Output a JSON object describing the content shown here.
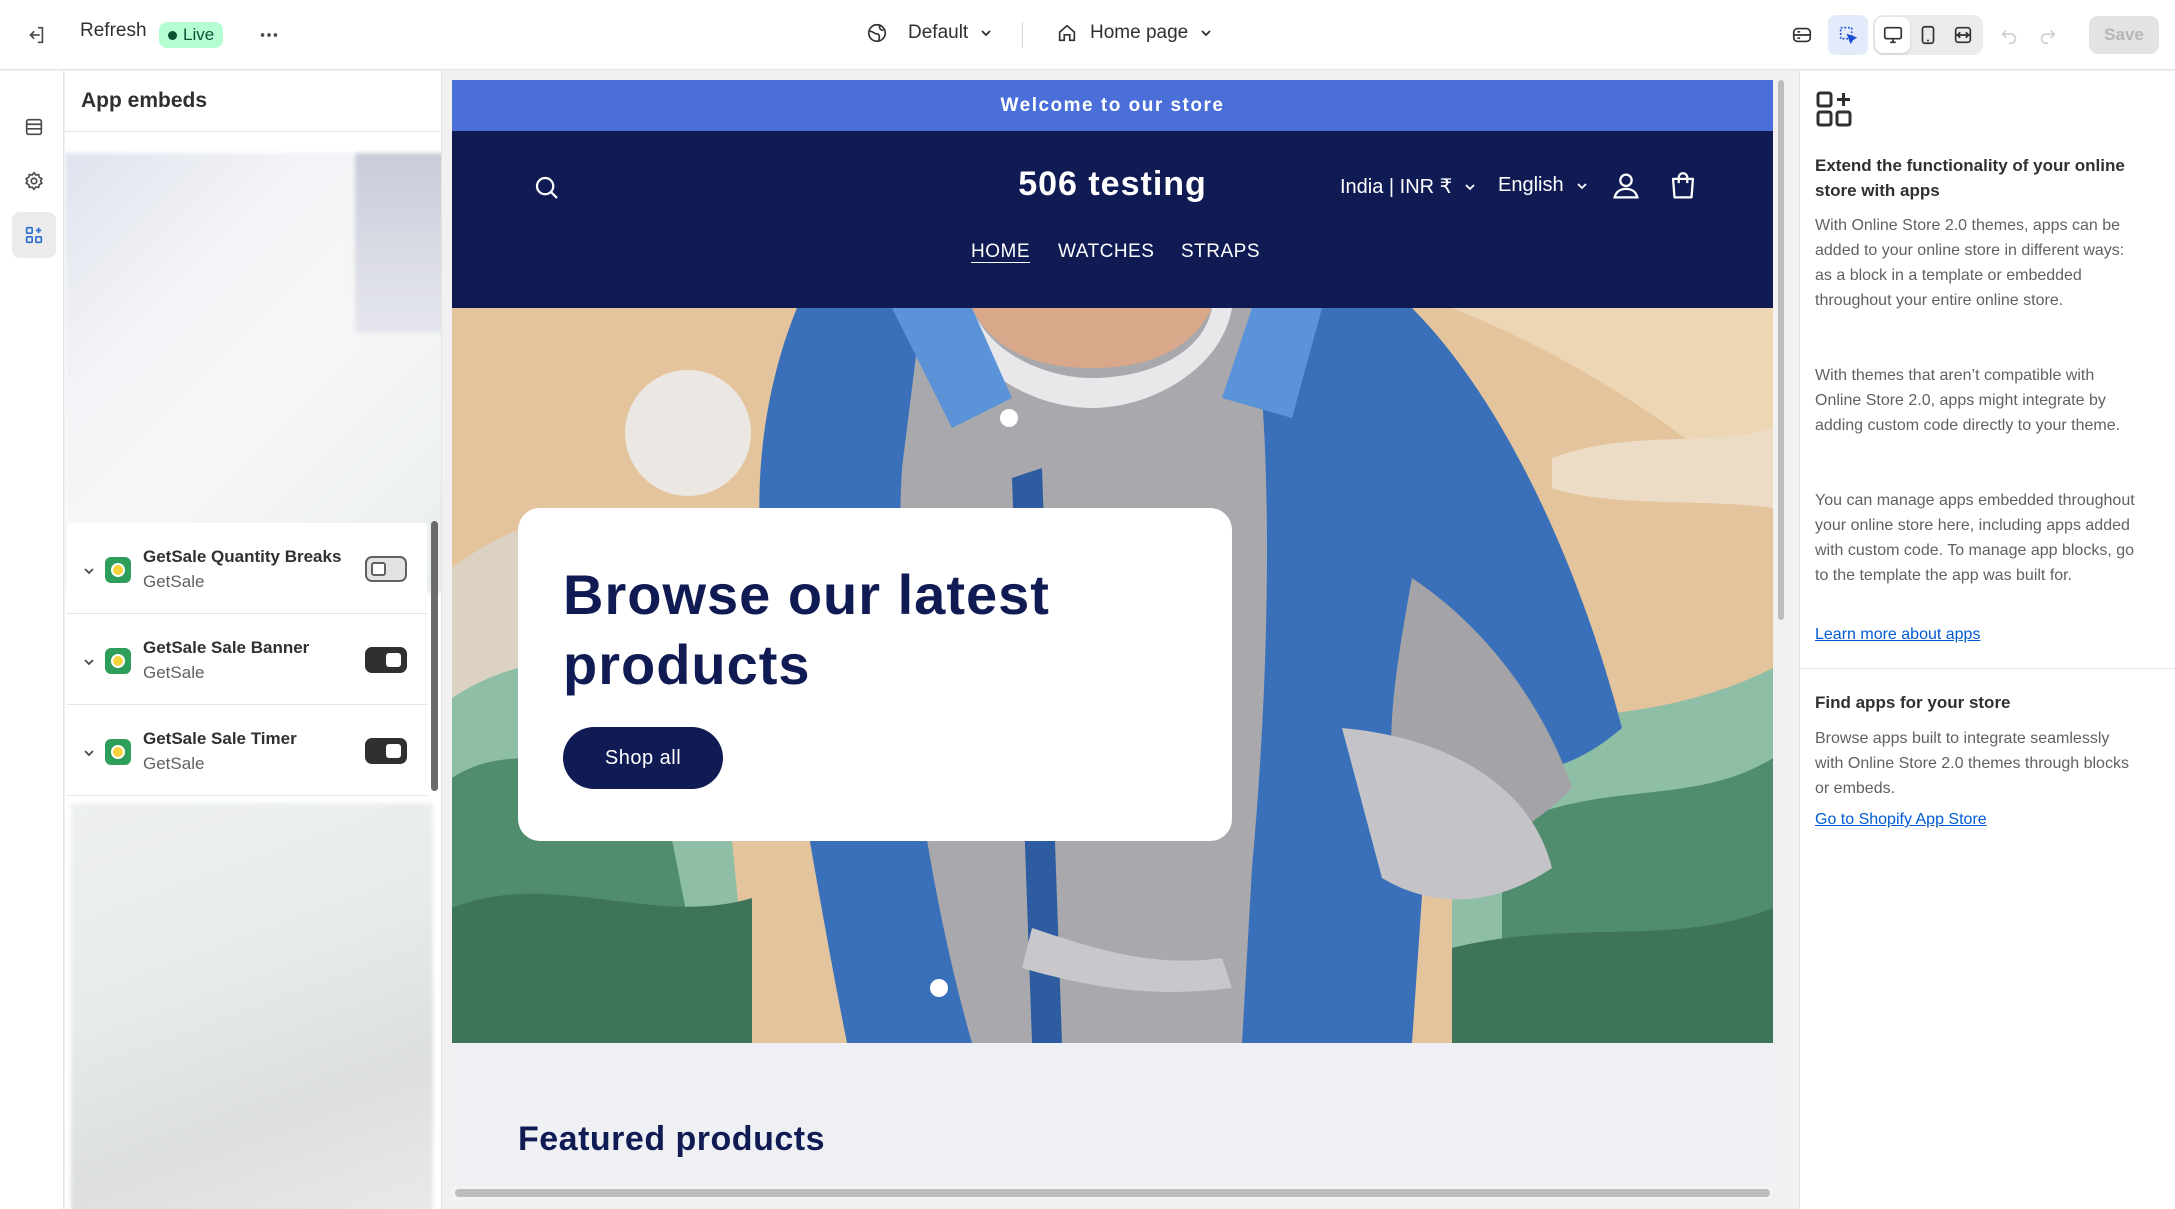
{
  "topbar": {
    "refresh_label": "Refresh",
    "live_label": "Live",
    "theme_label": "Default",
    "page_label": "Home page",
    "save_label": "Save"
  },
  "panel": {
    "title": "App embeds",
    "embeds": [
      {
        "name": "GetSale Quantity Breaks",
        "vendor": "GetSale",
        "enabled": false
      },
      {
        "name": "GetSale Sale Banner",
        "vendor": "GetSale",
        "enabled": true
      },
      {
        "name": "GetSale Sale Timer",
        "vendor": "GetSale",
        "enabled": true
      }
    ]
  },
  "preview": {
    "announcement": "Welcome to our store",
    "store_name": "506 testing",
    "country": "India | INR ₹",
    "language": "English",
    "nav": [
      "HOME",
      "WATCHES",
      "STRAPS"
    ],
    "hero_title": "Browse our latest products",
    "hero_button": "Shop all",
    "featured_title": "Featured products"
  },
  "rpanel": {
    "heading1": "Extend the functionality of your online store with apps",
    "p1": "With Online Store 2.0 themes, apps can be added to your online store in different ways: as a block in a template or embedded throughout your entire online store.",
    "p2": "With themes that aren’t compatible with Online Store 2.0, apps might integrate by adding custom code directly to your theme.",
    "p3": "You can manage apps embedded throughout your online store here, including apps added with custom code. To manage app blocks, go to the template the app was built for.",
    "link1": "Learn more about apps",
    "heading2": "Find apps for your store",
    "p4": "Browse apps built to integrate seamlessly with Online Store 2.0 themes through blocks or embeds.",
    "link2": "Go to Shopify App Store"
  },
  "colors": {
    "header_navy": "#101b54",
    "announcement_blue": "#4a6fd8",
    "live_green": "#b4fed2",
    "link_blue": "#005bd3"
  },
  "icons": [
    "exit-icon",
    "more-icon",
    "globe-icon",
    "home-icon",
    "database-icon",
    "inspector-icon",
    "desktop-icon",
    "mobile-icon",
    "fullwidth-icon",
    "undo-icon",
    "redo-icon",
    "sections-icon",
    "settings-gear-icon",
    "apps-icon",
    "search-icon",
    "account-icon",
    "cart-icon"
  ]
}
